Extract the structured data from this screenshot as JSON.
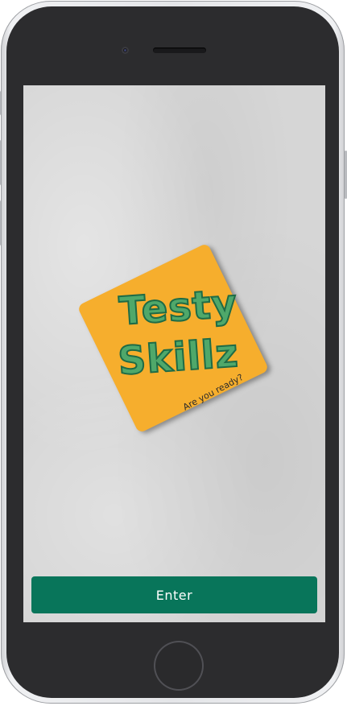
{
  "app": {
    "logo": {
      "line1": "Testy",
      "line2": "Skillz",
      "tagline": "Are you ready?"
    },
    "enter_label": "Enter"
  },
  "colors": {
    "logo_card": "#f6ae2d",
    "logo_text": "#4fa86a",
    "button_bg": "#08755a",
    "screen_bg": "#d6d6d6"
  }
}
